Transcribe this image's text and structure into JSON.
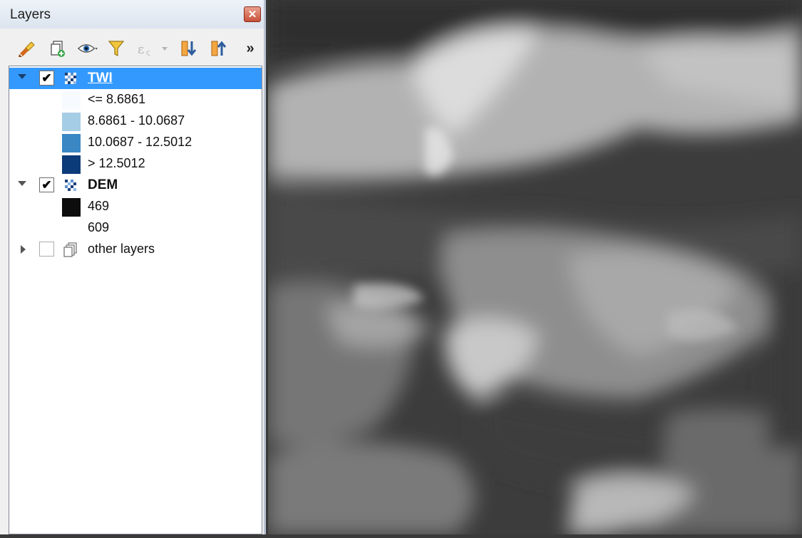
{
  "panel": {
    "title": "Layers",
    "close_glyph": "✕"
  },
  "toolbar": {
    "items": [
      {
        "icon": "paint-brush-icon"
      },
      {
        "icon": "add-group-icon"
      },
      {
        "icon": "eye-icon"
      },
      {
        "icon": "filter-icon"
      },
      {
        "icon": "expression-filter-icon",
        "disabled": true
      },
      {
        "icon": "expand-all-icon"
      },
      {
        "icon": "collapse-all-icon"
      }
    ],
    "more_glyph": "»"
  },
  "layers": [
    {
      "name": "TWI",
      "checked": true,
      "selected": true,
      "legend": [
        {
          "label": "<= 8.6861",
          "color": "#f7fbff"
        },
        {
          "label": "8.6861 - 10.0687",
          "color": "#a6cde6"
        },
        {
          "label": "10.0687 - 12.5012",
          "color": "#3a87c4"
        },
        {
          "label": "> 12.5012",
          "color": "#0c3b7a"
        }
      ]
    },
    {
      "name": "DEM",
      "checked": true,
      "selected": false,
      "legend": [
        {
          "label": "469",
          "color": "#0d0d0d"
        },
        {
          "label": "609",
          "color": "#ffffff"
        }
      ]
    }
  ],
  "group": {
    "name": "other layers",
    "checked": false
  },
  "check_glyph": "✔",
  "colors": {
    "selection": "#3399ff",
    "map_dark": "#3a3a3a",
    "map_light": "#e6e6e6"
  }
}
